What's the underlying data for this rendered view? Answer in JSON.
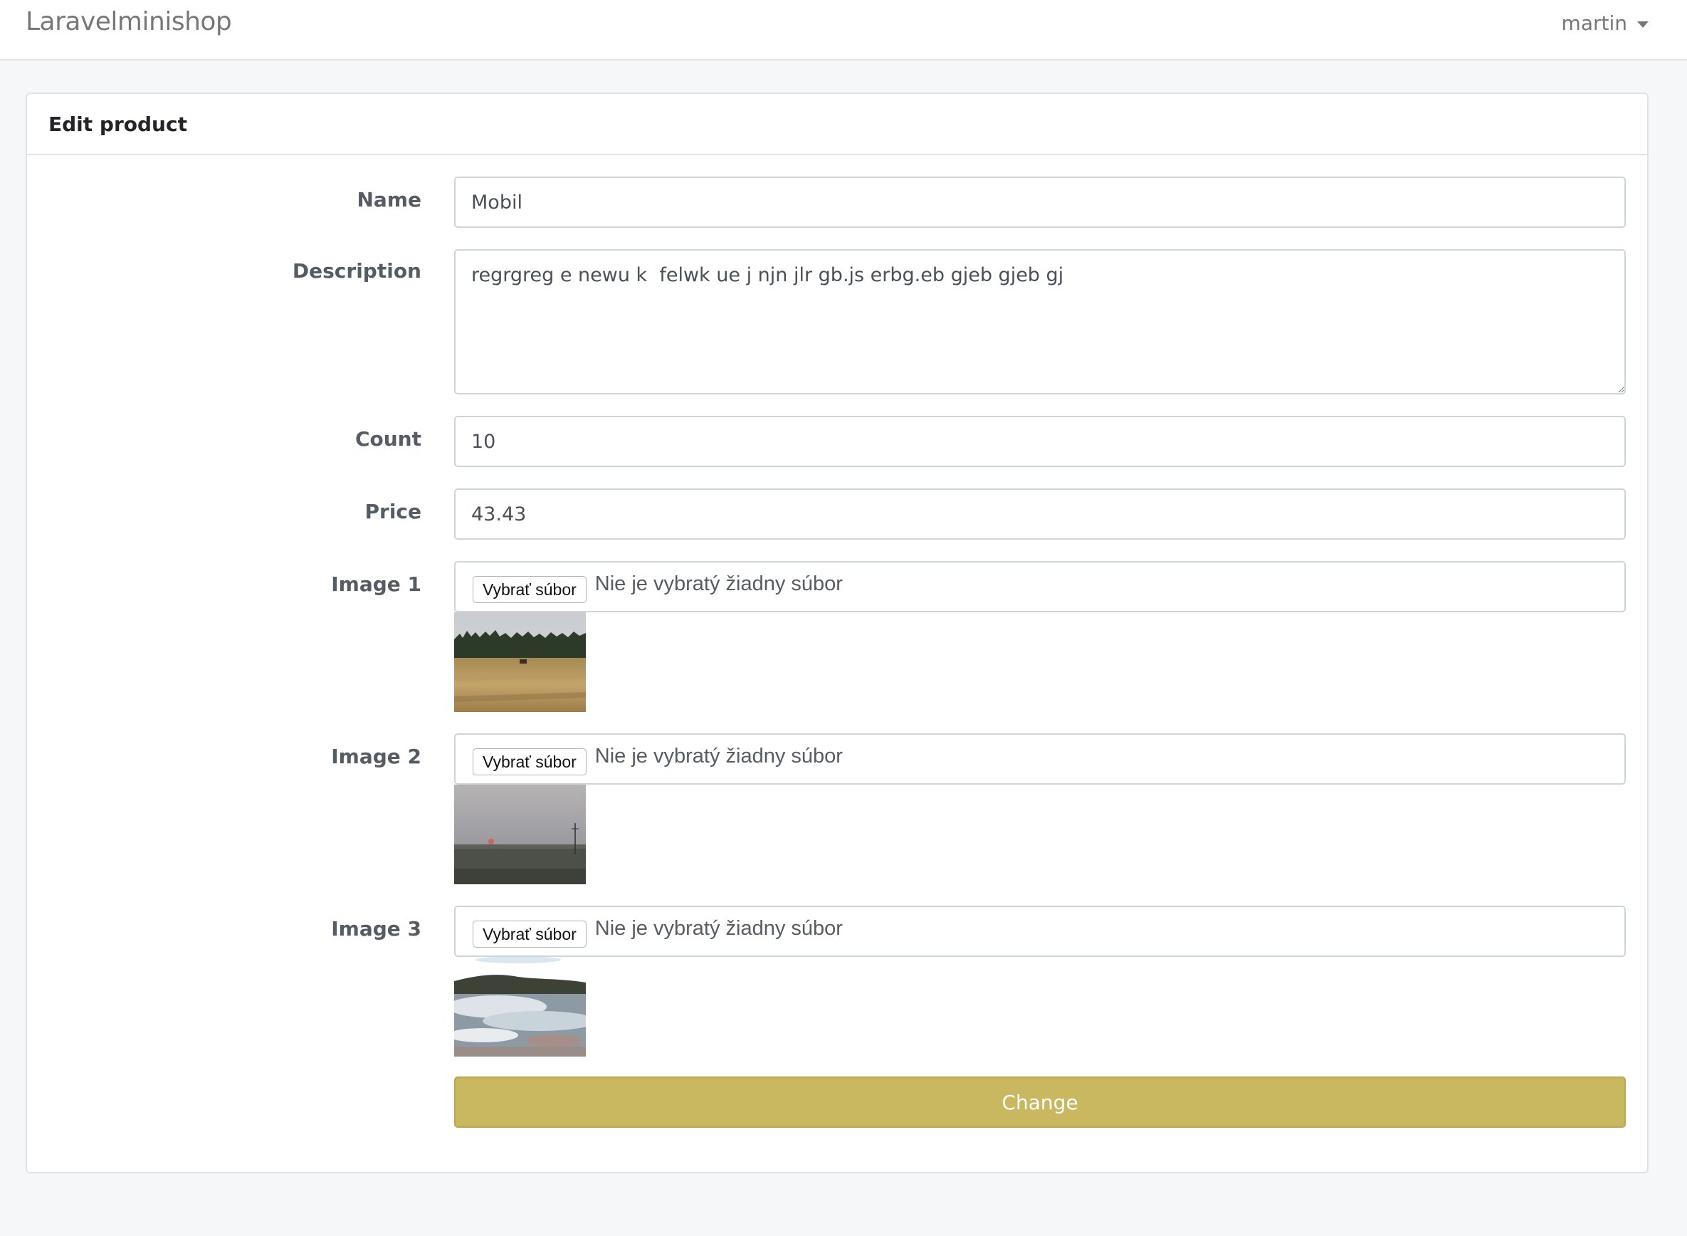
{
  "navbar": {
    "brand": "Laravelminishop",
    "user": "martin"
  },
  "card": {
    "title": "Edit product"
  },
  "form": {
    "name_label": "Name",
    "name_value": "Mobil",
    "description_label": "Description",
    "description_value": "regrgreg e newu k  felwk ue j njn jlr gb.js erbg.eb gjeb gjeb gj",
    "count_label": "Count",
    "count_value": "10",
    "price_label": "Price",
    "price_value": "43.43",
    "images": [
      {
        "label": "Image 1",
        "button": "Vybrať súbor",
        "status": "Nie je vybratý žiadny súbor",
        "thumb": "grassland-forest-photo"
      },
      {
        "label": "Image 2",
        "button": "Vybrať súbor",
        "status": "Nie je vybratý žiadny súbor",
        "thumb": "sunset-plain-photo"
      },
      {
        "label": "Image 3",
        "button": "Vybrať súbor",
        "status": "Nie je vybratý žiadny súbor",
        "thumb": "hot-spring-steam-photo"
      }
    ],
    "submit_label": "Change"
  },
  "colors": {
    "accent": "#c9b85f",
    "page_bg": "#f5f7f9",
    "border": "#ced4da"
  }
}
